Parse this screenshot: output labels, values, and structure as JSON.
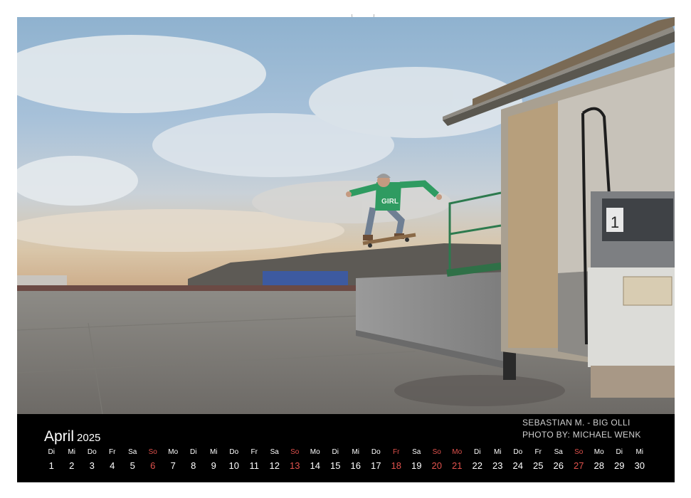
{
  "photo": {
    "subject": "skateboarder-jumping",
    "shirt_text": "GIRL",
    "pump_number": "1"
  },
  "calendar": {
    "month": "April",
    "year": "2025",
    "credits": {
      "line1": "SEBASTIAN M. - BIG OLLI",
      "line2": "PHOTO BY: MICHAEL WENK"
    },
    "days": [
      {
        "wd": "Di",
        "d": "1"
      },
      {
        "wd": "Mi",
        "d": "2"
      },
      {
        "wd": "Do",
        "d": "3"
      },
      {
        "wd": "Fr",
        "d": "4"
      },
      {
        "wd": "Sa",
        "d": "5"
      },
      {
        "wd": "So",
        "d": "6"
      },
      {
        "wd": "Mo",
        "d": "7"
      },
      {
        "wd": "Di",
        "d": "8"
      },
      {
        "wd": "Mi",
        "d": "9"
      },
      {
        "wd": "Do",
        "d": "10"
      },
      {
        "wd": "Fr",
        "d": "11"
      },
      {
        "wd": "Sa",
        "d": "12"
      },
      {
        "wd": "So",
        "d": "13"
      },
      {
        "wd": "Mo",
        "d": "14"
      },
      {
        "wd": "Di",
        "d": "15"
      },
      {
        "wd": "Mi",
        "d": "16"
      },
      {
        "wd": "Do",
        "d": "17"
      },
      {
        "wd": "Fr",
        "d": "18"
      },
      {
        "wd": "Sa",
        "d": "19"
      },
      {
        "wd": "So",
        "d": "20"
      },
      {
        "wd": "Mo",
        "d": "21"
      },
      {
        "wd": "Di",
        "d": "22"
      },
      {
        "wd": "Mi",
        "d": "23"
      },
      {
        "wd": "Do",
        "d": "24"
      },
      {
        "wd": "Fr",
        "d": "25"
      },
      {
        "wd": "Sa",
        "d": "26"
      },
      {
        "wd": "So",
        "d": "27"
      },
      {
        "wd": "Mo",
        "d": "28"
      },
      {
        "wd": "Di",
        "d": "29"
      },
      {
        "wd": "Mi",
        "d": "30"
      }
    ],
    "highlight_color": "#e1524d"
  }
}
